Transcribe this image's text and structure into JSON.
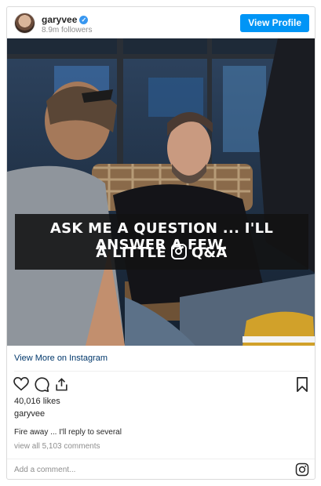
{
  "header": {
    "username": "garyvee",
    "followers": "8.9m followers",
    "view_profile_label": "View Profile"
  },
  "photo": {
    "banner_line1": "ASK ME A QUESTION ... I'LL ANSWER A FEW.",
    "banner_line2_left": "A LITTLE",
    "banner_line2_right": "Q&A"
  },
  "links": {
    "view_more": "View More on Instagram"
  },
  "stats": {
    "likes": "40,016 likes",
    "username": "garyvee",
    "caption": "Fire away ... I'll reply to several",
    "view_comments": "view all 5,103 comments"
  },
  "comment_input": {
    "placeholder": "Add a comment..."
  },
  "colors": {
    "accent": "#0095f6",
    "link": "#00376b",
    "muted": "#8e8e8e"
  },
  "icons": [
    "verified-badge-icon",
    "heart-icon",
    "comment-icon",
    "share-icon",
    "bookmark-icon",
    "instagram-icon"
  ]
}
